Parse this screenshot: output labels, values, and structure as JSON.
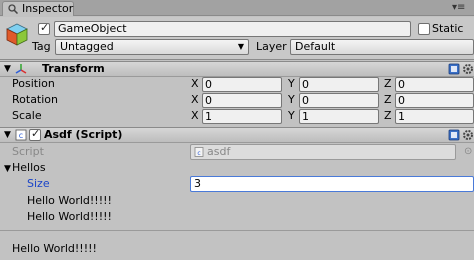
{
  "tab": {
    "label": "Inspector",
    "icon": "inspector-icon",
    "menu_icon": "panel-menu-icon"
  },
  "gameobject": {
    "active": true,
    "name": "GameObject",
    "static_label": "Static",
    "static_checked": false,
    "tag_label": "Tag",
    "tag_value": "Untagged",
    "layer_label": "Layer",
    "layer_value": "Default"
  },
  "transform": {
    "title": "Transform",
    "rows": [
      {
        "label": "Position",
        "x": "0",
        "y": "0",
        "z": "0"
      },
      {
        "label": "Rotation",
        "x": "0",
        "y": "0",
        "z": "0"
      },
      {
        "label": "Scale",
        "x": "1",
        "y": "1",
        "z": "1"
      }
    ],
    "axis": {
      "x": "X",
      "y": "Y",
      "z": "Z"
    }
  },
  "script_component": {
    "title": "Asdf (Script)",
    "enabled": true,
    "script_label": "Script",
    "script_value": "asdf",
    "hellos_label": "Hellos",
    "size_label": "Size",
    "size_value": "3",
    "elements": [
      "Hello World!!!!!",
      "Hello World!!!!!"
    ],
    "extra_label": "Hello World!!!!!"
  },
  "colors": {
    "accent": "#1a44c8",
    "panel": "#c2c2c2"
  }
}
